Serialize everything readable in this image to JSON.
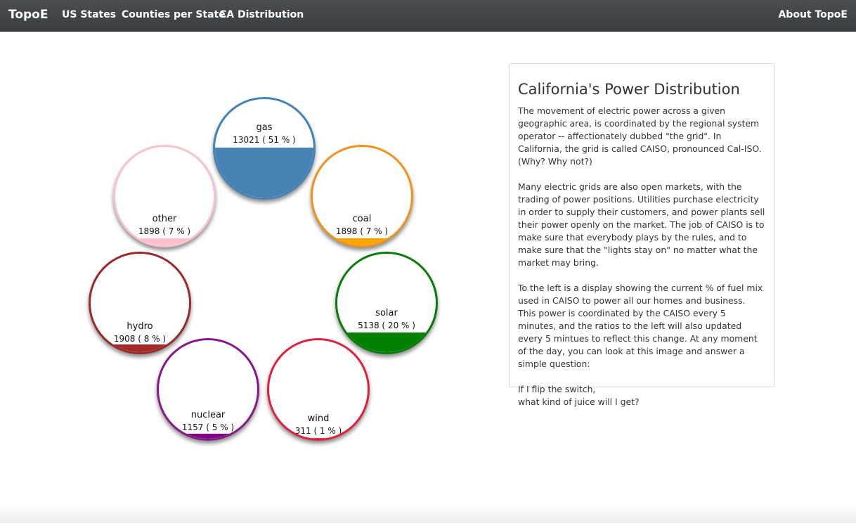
{
  "nav": {
    "brand": "TopoE",
    "links": [
      "US States",
      "Counties per State",
      "CA Distribution"
    ],
    "about": "About TopoE"
  },
  "bubbles": [
    {
      "name": "gas",
      "value": "13021 ( 51 % )",
      "fraction": 0.51,
      "color": "#4682b4",
      "border": "#4682b4"
    },
    {
      "name": "coal",
      "value": "1898 ( 7 % )",
      "fraction": 0.07,
      "color": "#ffa500",
      "border": "#f0921e"
    },
    {
      "name": "solar",
      "value": "5138 ( 20 % )",
      "fraction": 0.2,
      "color": "#008000",
      "border": "#0a7a0a"
    },
    {
      "name": "wind",
      "value": "311 ( 1 % )",
      "fraction": 0.01,
      "color": "#dc143c",
      "border": "#e0203c"
    },
    {
      "name": "nuclear",
      "value": "1157 ( 5 % )",
      "fraction": 0.05,
      "color": "#800080",
      "border": "#86198a"
    },
    {
      "name": "hydro",
      "value": "1908 ( 8 % )",
      "fraction": 0.08,
      "color": "#a52a2a",
      "border": "#9a2a2a"
    },
    {
      "name": "other",
      "value": "1898 ( 7 % )",
      "fraction": 0.07,
      "color": "#ffc0cb",
      "border": "#f7c3cd"
    }
  ],
  "panel": {
    "title": "California's Power Distribution",
    "p1": "The movement of electric power across a given geographic area, is coordinated by the regional system operator -- affectionately dubbed \"the grid\". In California, the grid is called CAISO, pronounced Cal-ISO. (Why? Why not?)",
    "p2": "Many electric grids are also open markets, with the trading of power positions. Utilities purchase electricity in order to supply their customers, and power plants sell their power openly on the market. The job of CAISO is to make sure that everybody plays by the rules, and to make sure that the \"lights stay on\" no matter what the market may bring.",
    "p3": "To the left is a display showing the current % of fuel mix used in CAISO to power all our homes and business. This power is coordinated by the CAISO every 5 minutes, and the ratios to the left will also updated every 5 mintues to reflect this change. At any moment of the day, you can look at this image and answer a simple question:",
    "q1": "If I flip the switch,",
    "q2": "what kind of juice will I get?"
  }
}
